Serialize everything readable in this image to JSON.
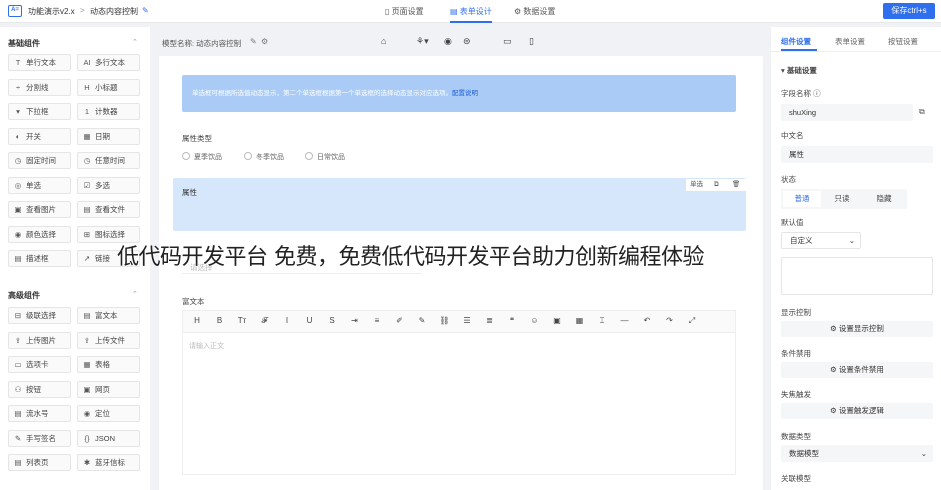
{
  "topbar": {
    "app_name": "功能演示v2.x",
    "crumb_sep": ">",
    "page_name": "动态内容控制",
    "tabs": [
      "页面设置",
      "表单设计",
      "数据设置"
    ],
    "save_label": "保存ctrl+s"
  },
  "left": {
    "basic_title": "基础组件",
    "basic": [
      {
        "icon": "T",
        "label": "单行文本"
      },
      {
        "icon": "AI",
        "label": "多行文本"
      },
      {
        "icon": "÷",
        "label": "分割线"
      },
      {
        "icon": "H",
        "label": "小标题"
      },
      {
        "icon": "▾",
        "label": "下拉框"
      },
      {
        "icon": "1",
        "label": "计数器"
      },
      {
        "icon": "◐",
        "label": "开关"
      },
      {
        "icon": "▦",
        "label": "日期"
      },
      {
        "icon": "◷",
        "label": "固定时间"
      },
      {
        "icon": "◷",
        "label": "任意时间"
      },
      {
        "icon": "◎",
        "label": "单选"
      },
      {
        "icon": "☑",
        "label": "多选"
      },
      {
        "icon": "▣",
        "label": "查看图片"
      },
      {
        "icon": "▤",
        "label": "查看文件"
      },
      {
        "icon": "◉",
        "label": "颜色选择"
      },
      {
        "icon": "⊞",
        "label": "图标选择"
      },
      {
        "icon": "▤",
        "label": "描述框"
      },
      {
        "icon": "↗",
        "label": "链接"
      }
    ],
    "advanced_title": "高级组件",
    "advanced": [
      {
        "icon": "⊟",
        "label": "级联选择"
      },
      {
        "icon": "▤",
        "label": "富文本"
      },
      {
        "icon": "⇪",
        "label": "上传图片"
      },
      {
        "icon": "⇪",
        "label": "上传文件"
      },
      {
        "icon": "▭",
        "label": "选项卡"
      },
      {
        "icon": "▦",
        "label": "表格"
      },
      {
        "icon": "⚇",
        "label": "按钮"
      },
      {
        "icon": "▣",
        "label": "网页"
      },
      {
        "icon": "▤",
        "label": "流水号"
      },
      {
        "icon": "◉",
        "label": "定位"
      },
      {
        "icon": "✎",
        "label": "手写签名"
      },
      {
        "icon": "{}",
        "label": "JSON"
      },
      {
        "icon": "▤",
        "label": "列表页"
      },
      {
        "icon": "✱",
        "label": "蓝牙信标"
      }
    ]
  },
  "canvas": {
    "model_label": "模型名称: 动态内容控制",
    "notice_text": "单选框可根据所选值动态显示，第二个单选框根据第一个单选框的选择动态显示对应选项。",
    "notice_link": "配置说明",
    "attr_type_label": "属性类型",
    "radios": [
      "夏季饮品",
      "冬季饮品",
      "日常饮品"
    ],
    "field_label": "属性",
    "field_tools": [
      "单选"
    ],
    "hidden_label": "请选择",
    "richtext_label": "富文本",
    "toolbar": [
      "H",
      "B",
      "Tт",
      "𝓕",
      "I",
      "U",
      "S",
      "⇥",
      "≡",
      "✐",
      "✎",
      "⛓",
      "☰",
      "≣",
      "❝",
      "☺",
      "▣",
      "▦",
      "⌶",
      "—",
      "↶",
      "↷",
      "⤢"
    ],
    "editor_placeholder": "请输入正文"
  },
  "right": {
    "tabs": [
      "组件设置",
      "表单设置",
      "按钮设置"
    ],
    "section": "基础设置",
    "field_name_label": "字段名称",
    "field_name_value": "shuXing",
    "cn_name_label": "中文名",
    "cn_name_value": "属性",
    "state_label": "状态",
    "states": [
      "普通",
      "只读",
      "隐藏"
    ],
    "default_label": "默认值",
    "default_value": "自定义",
    "display_ctrl_label": "显示控制",
    "display_ctrl_btn": "设置显示控制",
    "cond_disable_label": "条件禁用",
    "cond_disable_btn": "设置条件禁用",
    "blur_label": "失焦触发",
    "blur_btn": "设置触发逻辑",
    "data_type_label": "数据类型",
    "data_type_value": "数据模型",
    "related_model_label": "关联模型"
  },
  "overlay_text": "低代码开发平台 免费，免费低代码开发平台助力创新编程体验",
  "colors": {
    "accent": "#2f6fed",
    "notice_bg": "#a9cbf5",
    "selected_bg": "#d6e6fb"
  }
}
